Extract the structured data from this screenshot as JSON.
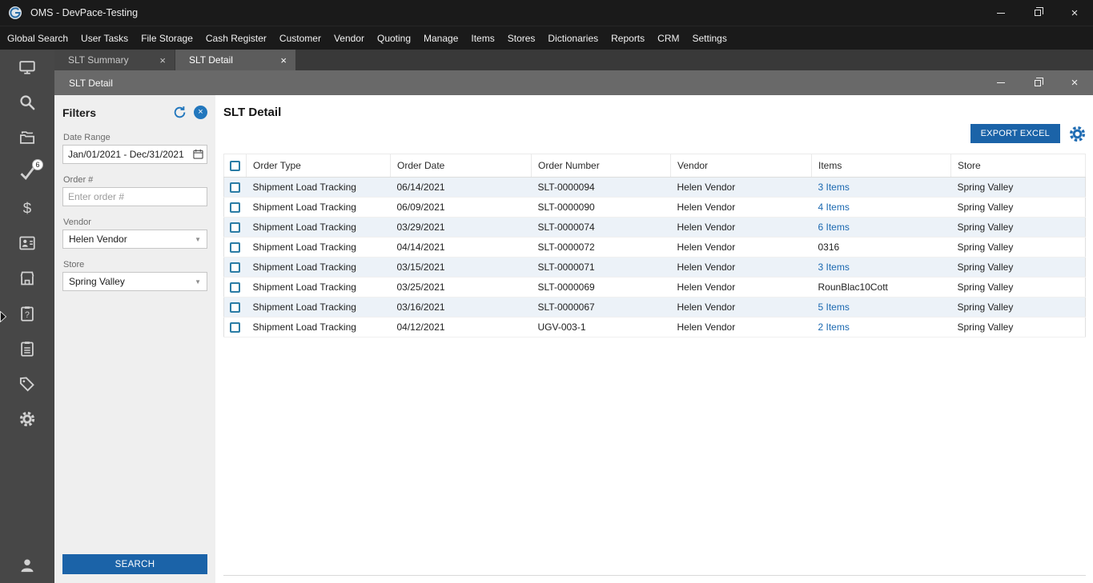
{
  "window": {
    "title": "OMS - DevPace-Testing"
  },
  "icons": {
    "close-icon": "×",
    "dropdown-arrow-icon": "▼",
    "app-logo": "circular-swirl",
    "minimize-icon": "horizontal-line",
    "restore-icon": "overlapping-squares",
    "refresh-icon": "circular-arrow",
    "clear-filters-icon": "circle-x",
    "calendar-icon": "calendar",
    "export-settings-icon": "gear",
    "flyout-arrow-icon": "right-triangle",
    "checkbox": "square-outline"
  },
  "menu": {
    "items": [
      "Global Search",
      "User Tasks",
      "File Storage",
      "Cash Register",
      "Customer",
      "Vendor",
      "Quoting",
      "Manage",
      "Items",
      "Stores",
      "Dictionaries",
      "Reports",
      "CRM",
      "Settings"
    ]
  },
  "tabs": [
    {
      "label": "SLT Summary",
      "active": false
    },
    {
      "label": "SLT Detail",
      "active": true
    }
  ],
  "inner_window": {
    "title": "SLT Detail"
  },
  "sidebar": {
    "icons": [
      {
        "name": "dashboard-icon",
        "symbol": "#sym-dashboard"
      },
      {
        "name": "search-icon",
        "symbol": "#sym-search"
      },
      {
        "name": "folders-icon",
        "symbol": "#sym-folders"
      },
      {
        "name": "tasks-check-icon",
        "symbol": "#sym-check",
        "badge": "6"
      },
      {
        "name": "currency-icon",
        "symbol": "#sym-dollar"
      },
      {
        "name": "contacts-icon",
        "symbol": "#sym-contact"
      },
      {
        "name": "stores-icon",
        "symbol": "#sym-store"
      },
      {
        "name": "help-clipboard-icon",
        "symbol": "#sym-clipboard-question"
      },
      {
        "name": "tasks-clipboard-icon",
        "symbol": "#sym-clipboard"
      },
      {
        "name": "tags-icon",
        "symbol": "#sym-tag"
      },
      {
        "name": "settings-gear-icon",
        "symbol": "#sym-gear"
      }
    ],
    "bottom_icon": "user-icon"
  },
  "filters": {
    "title": "Filters",
    "date_range": {
      "label": "Date Range",
      "value": "Jan/01/2021 - Dec/31/2021"
    },
    "order_number": {
      "label": "Order #",
      "placeholder": "Enter order #"
    },
    "vendor": {
      "label": "Vendor",
      "value": "Helen Vendor"
    },
    "store": {
      "label": "Store",
      "value": "Spring Valley"
    },
    "search_label": "SEARCH"
  },
  "main": {
    "title": "SLT Detail",
    "export_label": "EXPORT EXCEL",
    "table": {
      "columns": [
        "Order Type",
        "Order Date",
        "Order Number",
        "Vendor",
        "Items",
        "Store"
      ],
      "rows": [
        {
          "order_type": "Shipment Load Tracking",
          "order_date": "06/14/2021",
          "order_number": "SLT-0000094",
          "vendor": "Helen Vendor",
          "items": "3 Items",
          "items_clickable": true,
          "store": "Spring Valley"
        },
        {
          "order_type": "Shipment Load Tracking",
          "order_date": "06/09/2021",
          "order_number": "SLT-0000090",
          "vendor": "Helen Vendor",
          "items": "4 Items",
          "items_clickable": true,
          "store": "Spring Valley"
        },
        {
          "order_type": "Shipment Load Tracking",
          "order_date": "03/29/2021",
          "order_number": "SLT-0000074",
          "vendor": "Helen Vendor",
          "items": "6 Items",
          "items_clickable": true,
          "store": "Spring Valley"
        },
        {
          "order_type": "Shipment Load Tracking",
          "order_date": "04/14/2021",
          "order_number": "SLT-0000072",
          "vendor": "Helen Vendor",
          "items": "0316",
          "items_clickable": false,
          "store": "Spring Valley"
        },
        {
          "order_type": "Shipment Load Tracking",
          "order_date": "03/15/2021",
          "order_number": "SLT-0000071",
          "vendor": "Helen Vendor",
          "items": "3 Items",
          "items_clickable": true,
          "store": "Spring Valley"
        },
        {
          "order_type": "Shipment Load Tracking",
          "order_date": "03/25/2021",
          "order_number": "SLT-0000069",
          "vendor": "Helen Vendor",
          "items": "RounBlac10Cott",
          "items_clickable": false,
          "store": "Spring Valley"
        },
        {
          "order_type": "Shipment Load Tracking",
          "order_date": "03/16/2021",
          "order_number": "SLT-0000067",
          "vendor": "Helen Vendor",
          "items": "5 Items",
          "items_clickable": true,
          "store": "Spring Valley"
        },
        {
          "order_type": "Shipment Load Tracking",
          "order_date": "04/12/2021",
          "order_number": "UGV-003-1",
          "vendor": "Helen Vendor",
          "items": "2 Items",
          "items_clickable": true,
          "store": "Spring Valley"
        }
      ]
    }
  },
  "colors": {
    "accent_blue": "#1b63a8",
    "link_blue": "#1a68b0",
    "checkbox_border": "#2a7ca5",
    "row_alt": "#ecf2f8",
    "titlebar_bg": "#1a1a1a",
    "sidebar_bg": "#474747",
    "inner_titlebar_bg": "#696969",
    "filters_bg": "#efefef"
  }
}
